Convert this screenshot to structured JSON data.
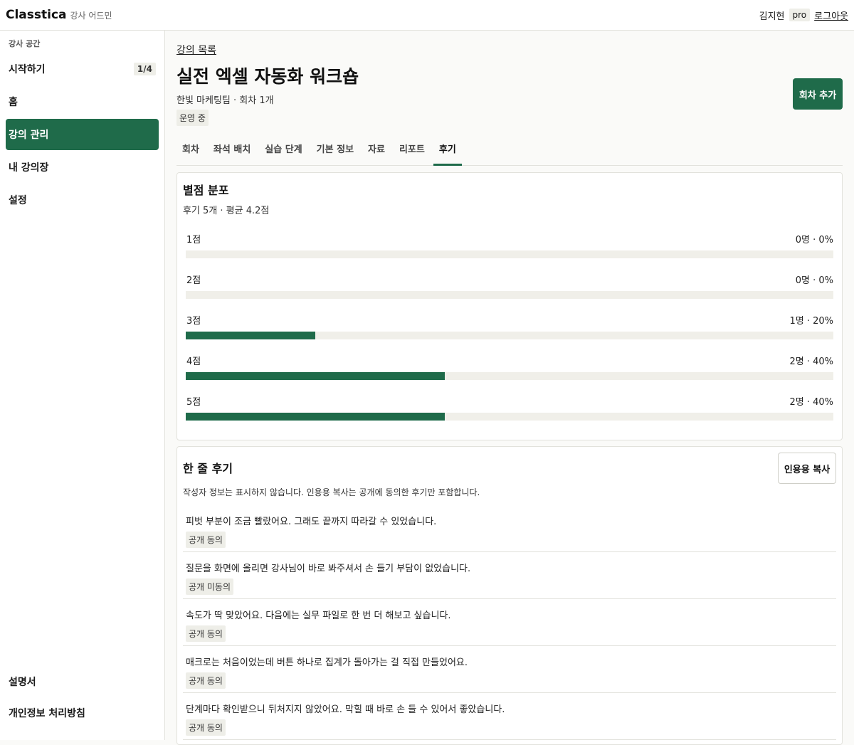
{
  "app": {
    "name": "Classtica",
    "subtitle": "강사 어드민"
  },
  "user": {
    "name": "김지현",
    "plan": "pro",
    "logout_label": "로그아웃"
  },
  "sidebar": {
    "section_label": "강사 공간",
    "items": [
      {
        "label": "시작하기",
        "count": "1/4"
      },
      {
        "label": "홈"
      },
      {
        "label": "강의 관리"
      },
      {
        "label": "내 강의장"
      },
      {
        "label": "설정"
      }
    ],
    "footer_items": [
      {
        "label": "설명서"
      },
      {
        "label": "개인정보 처리방침"
      }
    ]
  },
  "page": {
    "breadcrumb": "강의 목록",
    "title": "실전 엑셀 자동화 워크숍",
    "meta": "한빛 마케팅팀 · 회차 1개",
    "status": "운영 중",
    "add_session_label": "회차 추가"
  },
  "tabs": [
    "회차",
    "좌석 배치",
    "실습 단계",
    "기본 정보",
    "자료",
    "리포트",
    "후기"
  ],
  "rating_card": {
    "title": "별점 분포",
    "summary": "후기 5개 · 평균 4.2점",
    "rows": [
      {
        "label": "1점",
        "value": "0명 · 0%",
        "percent": 0
      },
      {
        "label": "2점",
        "value": "0명 · 0%",
        "percent": 0
      },
      {
        "label": "3점",
        "value": "1명 · 20%",
        "percent": 20
      },
      {
        "label": "4점",
        "value": "2명 · 40%",
        "percent": 40
      },
      {
        "label": "5점",
        "value": "2명 · 40%",
        "percent": 40
      }
    ],
    "accent_color": "#1f6b4a"
  },
  "review_card": {
    "title": "한 줄 후기",
    "copy_label": "인용용 복사",
    "note": "작성자 정보는 표시하지 않습니다. 인용용 복사는 공개에 동의한 후기만 포함합니다.",
    "reviews": [
      {
        "text": "피벗 부분이 조금 빨랐어요. 그래도 끝까지 따라갈 수 있었습니다.",
        "consent": "공개 동의"
      },
      {
        "text": "질문을 화면에 올리면 강사님이 바로 봐주셔서 손 들기 부담이 없었습니다.",
        "consent": "공개 미동의"
      },
      {
        "text": "속도가 딱 맞았어요. 다음에는 실무 파일로 한 번 더 해보고 싶습니다.",
        "consent": "공개 동의"
      },
      {
        "text": "매크로는 처음이었는데 버튼 하나로 집계가 돌아가는 걸 직접 만들었어요.",
        "consent": "공개 동의"
      },
      {
        "text": "단계마다 확인받으니 뒤처지지 않았어요. 막힐 때 바로 손 들 수 있어서 좋았습니다.",
        "consent": "공개 동의"
      }
    ]
  }
}
